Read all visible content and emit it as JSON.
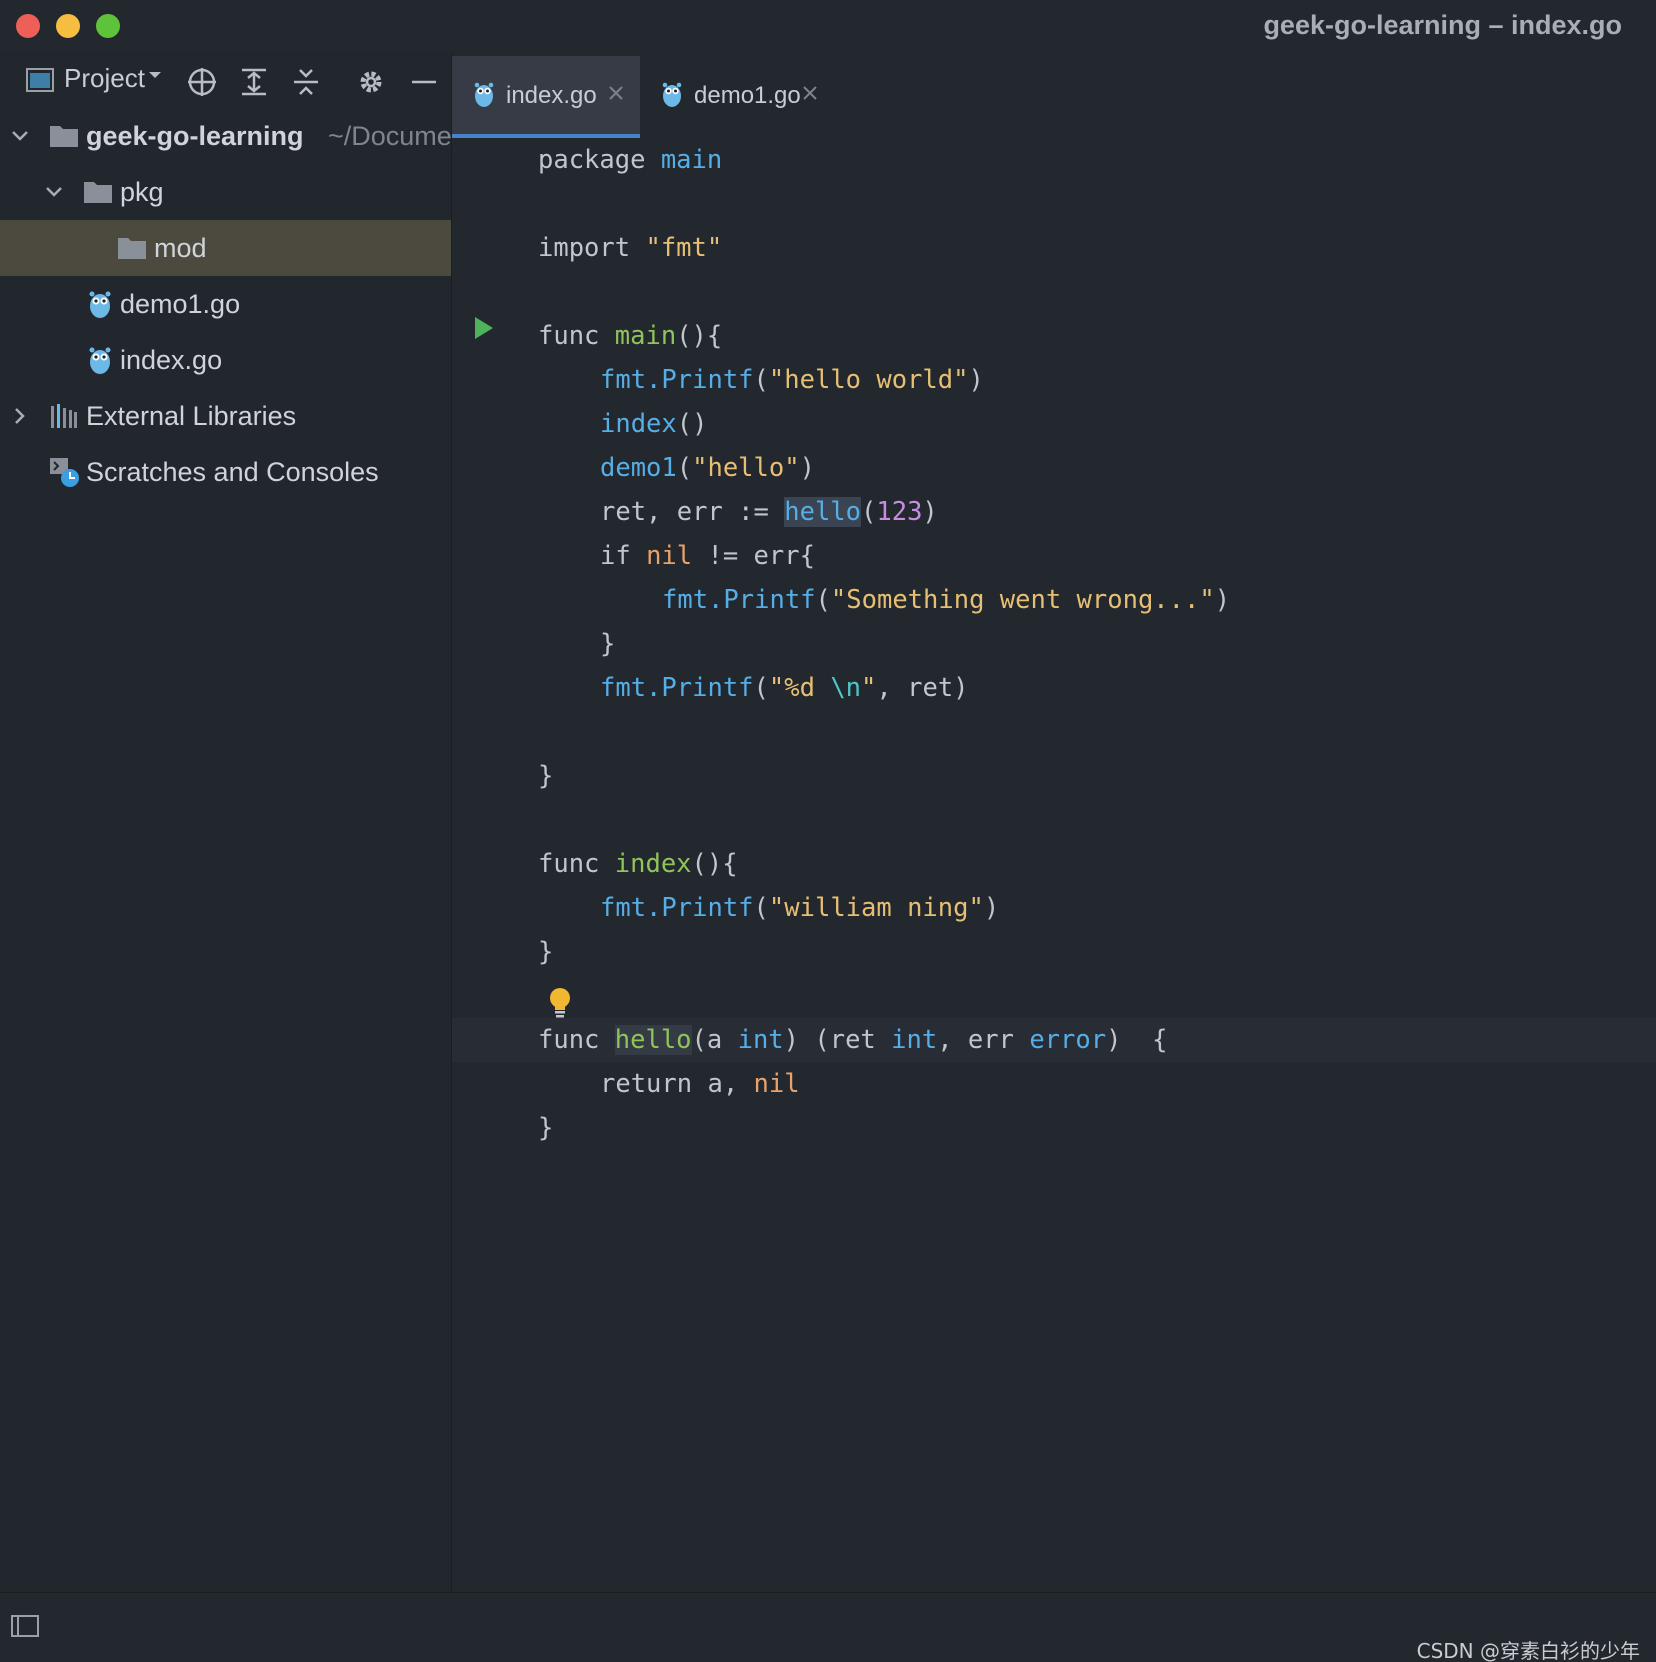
{
  "window": {
    "title": "geek-go-learning – index.go"
  },
  "sidebar": {
    "view_label": "Project",
    "tree": {
      "root_name": "geek-go-learning",
      "root_path": "~/Docume",
      "pkg": "pkg",
      "mod": "mod",
      "file1": "demo1.go",
      "file2": "index.go",
      "external": "External Libraries",
      "scratches": "Scratches and Consoles"
    }
  },
  "tabs": [
    {
      "label": "index.go",
      "active": true
    },
    {
      "label": "demo1.go",
      "active": false
    }
  ],
  "code": {
    "l1_kw": "package ",
    "l1_pkg": "main",
    "l3_kw": "import ",
    "l3_str": "\"fmt\"",
    "l5_kw": "func ",
    "l5_fn": "main",
    "l5_rest": "(){",
    "l6_pkg": "fmt.",
    "l6_call": "Printf",
    "l6_p1": "(",
    "l6_str": "\"hello world\"",
    "l6_p2": ")",
    "l7_call": "index",
    "l7_rest": "()",
    "l8_call": "demo1",
    "l8_p1": "(",
    "l8_str": "\"hello\"",
    "l8_p2": ")",
    "l9_pre": "ret, err := ",
    "l9_call": "hello",
    "l9_p1": "(",
    "l9_num": "123",
    "l9_p2": ")",
    "l10_kw": "if ",
    "l10_nil": "nil",
    "l10_rest": " != err{",
    "l11_pkg": "fmt.",
    "l11_call": "Printf",
    "l11_p1": "(",
    "l11_str": "\"Something went wrong...\"",
    "l11_p2": ")",
    "l12": "}",
    "l13_pkg": "fmt.",
    "l13_call": "Printf",
    "l13_p1": "(",
    "l13_str1": "\"%d ",
    "l13_esc": "\\n",
    "l13_str2": "\"",
    "l13_rest": ", ret)",
    "l15": "}",
    "l17_kw": "func ",
    "l17_fn": "index",
    "l17_rest": "(){",
    "l18_pkg": "fmt.",
    "l18_call": "Printf",
    "l18_p1": "(",
    "l18_str": "\"william ning\"",
    "l18_p2": ")",
    "l19": "}",
    "l21_kw": "func ",
    "l21_fn": "hello",
    "l21_a": "(a ",
    "l21_t1": "int",
    "l21_b": ") (ret ",
    "l21_t2": "int",
    "l21_c": ", err ",
    "l21_t3": "error",
    "l21_d": ")  {",
    "l22_kw": "return a, ",
    "l22_nil": "nil",
    "l23": "}"
  },
  "watermark": "CSDN @穿素白衫的少年",
  "colors": {
    "background": "#23272e",
    "selection": "#4c4a3f",
    "tab_active_underline": "#4a82c9",
    "keyword": "#c1c6cd",
    "string": "#e6bf74",
    "function_decl": "#8fc35c",
    "function_call": "#56aee6",
    "number": "#c58ee0",
    "nil": "#e8a26c"
  }
}
